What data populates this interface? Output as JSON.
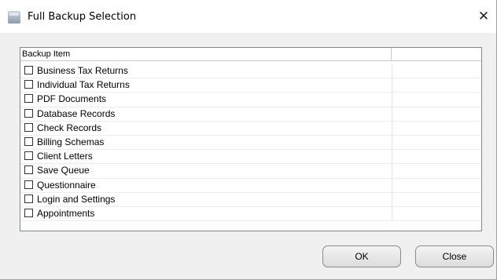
{
  "window": {
    "title": "Full Backup Selection",
    "close_glyph": "✕"
  },
  "list": {
    "column_header": "Backup Item",
    "items": [
      {
        "label": "Business Tax Returns",
        "checked": false
      },
      {
        "label": "Individual Tax Returns",
        "checked": false
      },
      {
        "label": "PDF Documents",
        "checked": false
      },
      {
        "label": "Database Records",
        "checked": false
      },
      {
        "label": "Check Records",
        "checked": false
      },
      {
        "label": "Billing Schemas",
        "checked": false
      },
      {
        "label": "Client Letters",
        "checked": false
      },
      {
        "label": "Save Queue",
        "checked": false
      },
      {
        "label": "Questionnaire",
        "checked": false
      },
      {
        "label": "Login and Settings",
        "checked": false
      },
      {
        "label": "Appointments",
        "checked": false
      }
    ]
  },
  "buttons": {
    "ok_label": "OK",
    "close_label": "Close"
  }
}
